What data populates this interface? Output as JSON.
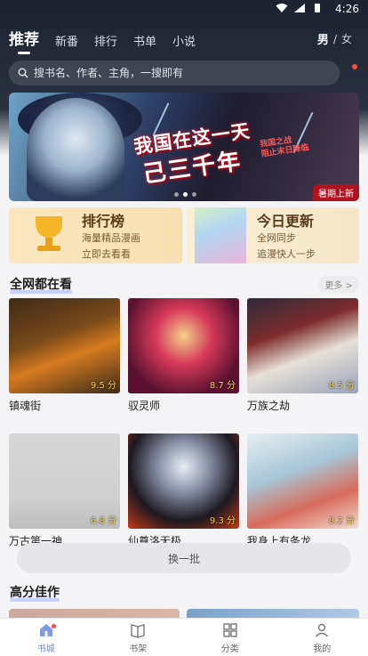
{
  "status_bar": {
    "time": "4:26"
  },
  "top_tabs": [
    {
      "label": "推荐",
      "active": true
    },
    {
      "label": "新番",
      "active": false
    },
    {
      "label": "排行",
      "active": false
    },
    {
      "label": "书单",
      "active": false
    },
    {
      "label": "小说",
      "active": false
    }
  ],
  "gender": {
    "male": "男",
    "separator": "/",
    "female": "女"
  },
  "search": {
    "placeholder": "搜书名、作者、主角，一搜即有",
    "icon": "search-icon"
  },
  "banner": {
    "title_line1": "我国在这一天",
    "title_line2": "己三千年",
    "sub_line1": "我国之战",
    "sub_line2": "阻止末日降临",
    "badge": "暑期上新",
    "slide_count": 3,
    "active_slide": 1
  },
  "promos": {
    "rank": {
      "title": "排行榜",
      "line1": "海量精品漫画",
      "line2": "立即去看看"
    },
    "update": {
      "title": "今日更新",
      "line1": "全网同步",
      "line2": "追漫快人一步"
    }
  },
  "sections": {
    "trending": {
      "title": "全网都在看",
      "more": "更多 >"
    },
    "top_rated": {
      "title": "高分佳作"
    }
  },
  "books": [
    {
      "title": "镇魂街",
      "score": "9.5 分"
    },
    {
      "title": "驭灵师",
      "score": "8.7 分"
    },
    {
      "title": "万族之劫",
      "score": "8.5 分"
    },
    {
      "title": "万古第一神",
      "score": "6.8 分"
    },
    {
      "title": "仙尊洛无极",
      "score": "9.3 分"
    },
    {
      "title": "我身上有条龙",
      "score": "8.2 分"
    }
  ],
  "refresh": {
    "label": "换一批"
  },
  "bottom_nav": [
    {
      "label": "书城",
      "icon": "home-icon",
      "active": true
    },
    {
      "label": "书架",
      "icon": "bookshelf-icon",
      "active": false
    },
    {
      "label": "分类",
      "icon": "category-icon",
      "active": false
    },
    {
      "label": "我的",
      "icon": "profile-icon",
      "active": false
    }
  ],
  "colors": {
    "accent": "#6c87e6",
    "header_bg": "#1d2330",
    "score": "#f5d04a",
    "badge": "#b3121f"
  }
}
